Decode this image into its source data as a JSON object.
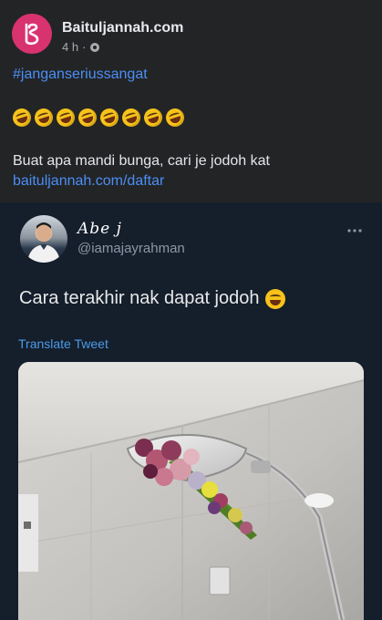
{
  "fb_post": {
    "page_name": "Baituljannah.com",
    "time": "4 h",
    "separator": "·",
    "hashtag": "#janganseriussangat",
    "emoji_count": 8,
    "body_text": "Buat apa mandi bunga, cari je jodoh kat",
    "link": "baituljannah.com/daftar",
    "colors": {
      "brand": "#d8336f",
      "link": "#4a8ff5",
      "background": "#232426"
    }
  },
  "tweet": {
    "display_name": "Abe j",
    "handle": "@iamajayrahman",
    "more_icon": "more-horizontal-icon",
    "text": "Cara terakhir nak dapat jodoh",
    "translate_label": "Translate Tweet",
    "media_icon": "photo-shower-flowers",
    "colors": {
      "background": "#151e2b",
      "link": "#4a9be8"
    }
  }
}
